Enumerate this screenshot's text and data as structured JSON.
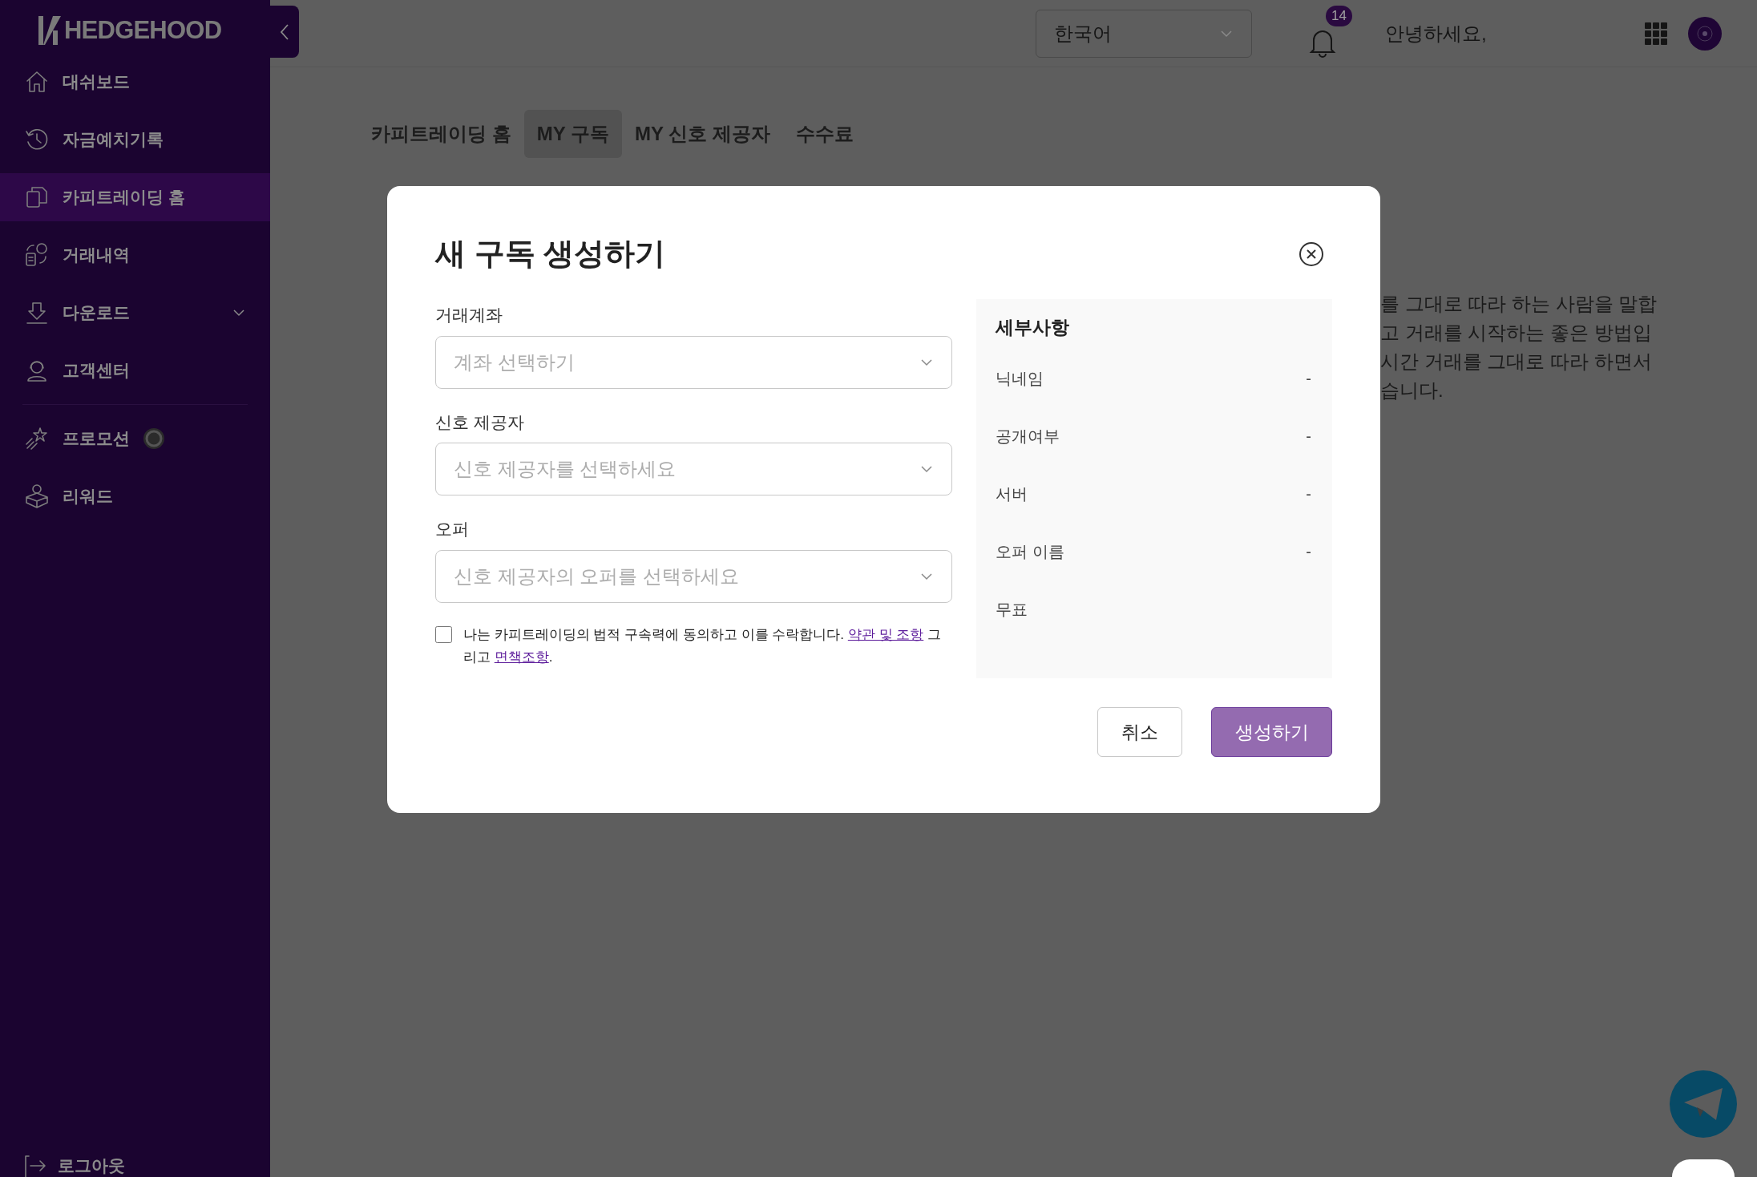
{
  "sidebar": {
    "logo": "HEDGEHOOD",
    "groups": [
      [
        {
          "label": "대쉬보드",
          "selected": false
        },
        {
          "label": "자금예치기록",
          "selected": false
        },
        {
          "label": "카피트레이딩 홈",
          "selected": true
        },
        {
          "label": "거래내역",
          "selected": false
        },
        {
          "label": "다운로드",
          "selected": false,
          "expanded": false
        },
        {
          "label": "고객센터",
          "selected": false
        }
      ],
      [
        {
          "label": "프로모션",
          "selected": false
        },
        {
          "label": "리워드",
          "selected": false
        }
      ]
    ],
    "logout": "로그아웃"
  },
  "header": {
    "language": "한국어",
    "notification_count": "14",
    "greeting": "안녕하세요,"
  },
  "tabs": [
    {
      "label": "카피트레이딩 홈",
      "selected": false
    },
    {
      "label": "MY 구독",
      "selected": true
    },
    {
      "label": "MY 신호 제공자",
      "selected": false
    },
    {
      "label": "수수료",
      "selected": false
    }
  ],
  "background_text": [
    "를 그대로 따라 하는 사람을 말합",
    "고 거래를 시작하는 좋은 방법입",
    "시간 거래를 그대로 따라 하면서",
    "습니다."
  ],
  "modal": {
    "title": "새 구독 생성하기",
    "fields": [
      {
        "label": "거래계좌",
        "placeholder": "계좌 선택하기"
      },
      {
        "label": "신호 제공자",
        "placeholder": "신호 제공자를 선택하세요"
      },
      {
        "label": "오퍼",
        "placeholder": "신호 제공자의 오퍼를 선택하세요"
      }
    ],
    "agreement": {
      "checked": false,
      "text": "나는 카피트레이딩의 법적 구속력에 동의하고 이를 수락합니다. ",
      "terms_link": "약관 및 조항",
      "middle": " 그리고 ",
      "disclaimer_link": "면책조항",
      "end": "."
    },
    "details": {
      "title": "세부사항",
      "rows": [
        {
          "label": "닉네임",
          "value": "-"
        },
        {
          "label": "공개여부",
          "value": "-"
        },
        {
          "label": "서버",
          "value": "-"
        },
        {
          "label": "오퍼 이름",
          "value": "-"
        },
        {
          "label": "무표"
        }
      ]
    },
    "cancel": "취소",
    "submit": "생성하기"
  }
}
